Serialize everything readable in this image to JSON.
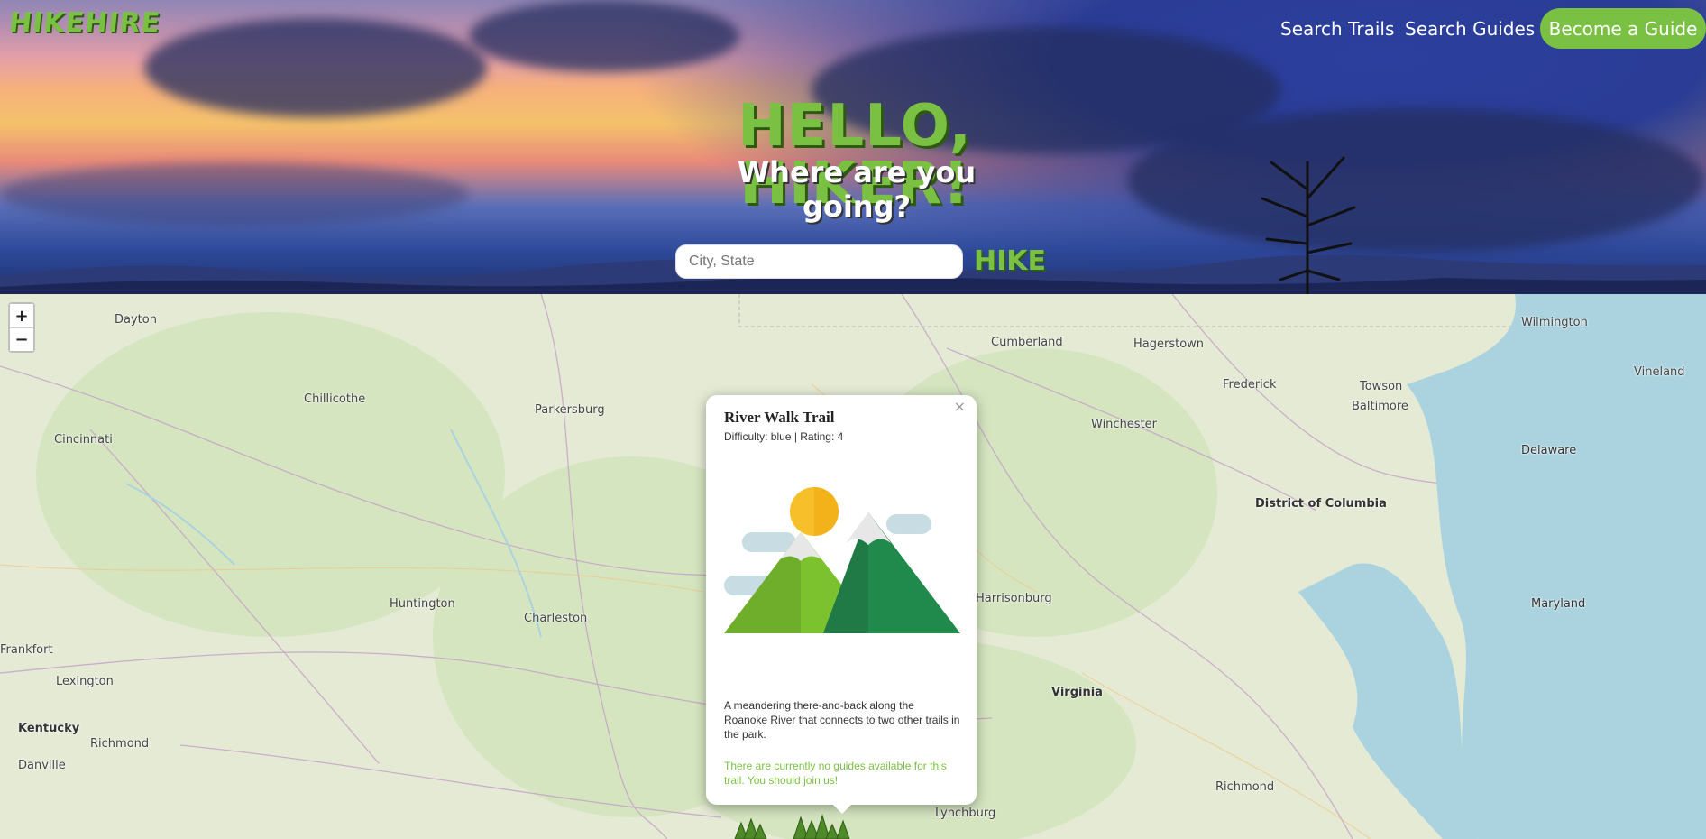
{
  "header": {
    "logo": "HIKEHIRE",
    "nav": {
      "search_trails": "Search Trails",
      "search_guides": "Search Guides",
      "become_guide": "Become a Guide"
    },
    "title": "HELLO, HIKER!",
    "subtitle": "Where are you going?",
    "search": {
      "placeholder": "City, State",
      "value": ""
    },
    "hike_button": "HIKE"
  },
  "map": {
    "zoom_in": "+",
    "zoom_out": "−",
    "labels": [
      "Dayton",
      "Cumberland",
      "Hagerstown",
      "Wilmington",
      "Chillicothe",
      "Parkersburg",
      "Frederick",
      "Towson",
      "Vineland",
      "Baltimore",
      "Cincinnati",
      "Winchester",
      "Delaware",
      "District of Columbia",
      "Huntington",
      "Charleston",
      "Harrisonburg",
      "Maryland",
      "Frankfort",
      "Lexington",
      "Virginia",
      "Kentucky",
      "Richmond",
      "Danville",
      "Richmond",
      "Lynchburg"
    ]
  },
  "popup": {
    "title": "River Walk Trail",
    "meta": "Difficulty: blue | Rating: 4",
    "description": "A meandering there-and-back along the Roanoke River that connects to two other trails in the park.",
    "note": "There are currently no guides available for this trail. You should join us!",
    "close": "×"
  },
  "colors": {
    "accent": "#7ac143",
    "water": "#aad3df",
    "land": "#e2e8d2"
  }
}
